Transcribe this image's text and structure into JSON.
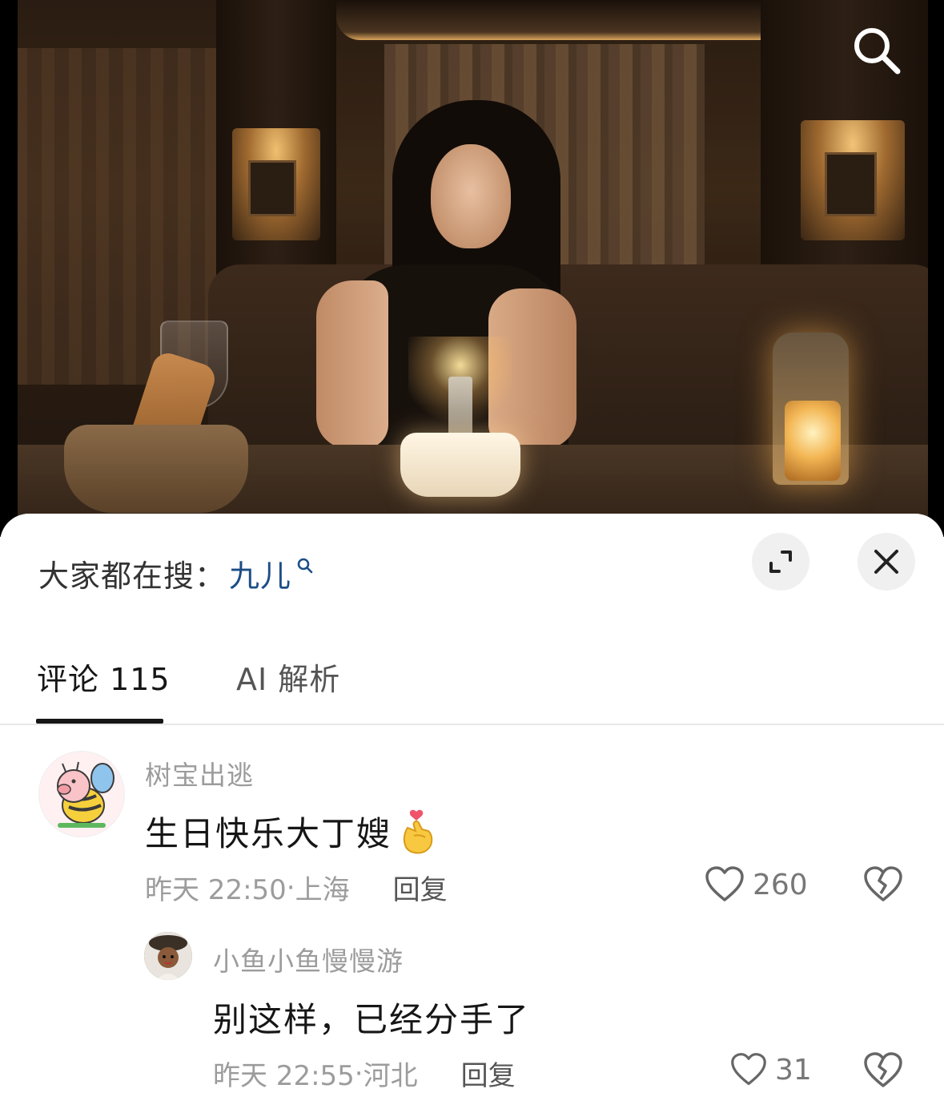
{
  "header": {
    "search_icon": "search-icon"
  },
  "sheet": {
    "trending_prefix": "大家都在搜",
    "trending_sep": "：",
    "trending_term": "九儿",
    "expand_icon": "expand-icon",
    "close_icon": "close-icon"
  },
  "tabs": [
    {
      "label": "评论 115",
      "active": true
    },
    {
      "label": "AI 解析",
      "active": false
    }
  ],
  "comments": [
    {
      "username": "树宝出逃",
      "text": "生日快乐大丁嫂",
      "emoji": "finger-heart-emoji",
      "time": "昨天 22:50",
      "location": "上海",
      "reply_label": "回复",
      "likes": "260"
    },
    {
      "username": "小鱼小鱼慢慢游",
      "text": "别这样，已经分手了",
      "time": "昨天 22:55",
      "location": "河北",
      "reply_label": "回复",
      "likes": "31"
    }
  ],
  "colors": {
    "accent_link": "#1c4e86",
    "text_primary": "#161616",
    "text_secondary": "#9c9c9c"
  }
}
